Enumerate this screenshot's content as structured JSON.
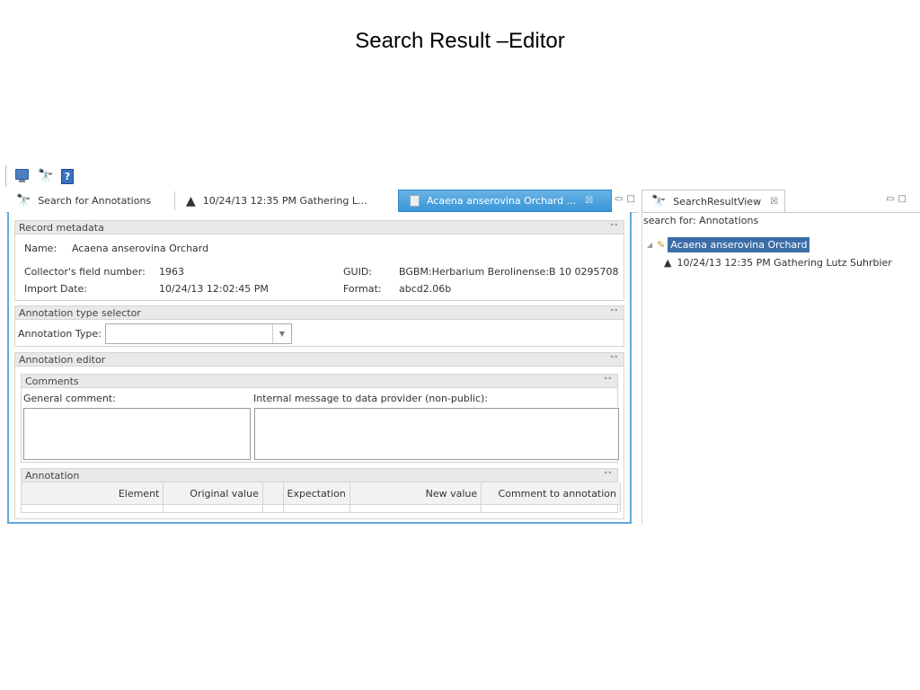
{
  "slide_title": "Search Result –Editor",
  "toolbar": {
    "icons": [
      "monitor-icon",
      "binoculars-icon",
      "help-icon"
    ]
  },
  "editor_tabs": [
    {
      "label": "Search for Annotations",
      "icon": "binoculars-icon"
    },
    {
      "label": "10/24/13 12:35 PM Gathering L...",
      "icon": "gathering-icon"
    },
    {
      "label": "Acaena anserovina Orchard ...",
      "icon": "document-icon",
      "active": true,
      "close": "☒"
    }
  ],
  "record_metadata": {
    "header": "Record metadata",
    "name_label": "Name:",
    "name_value": "Acaena anserovina Orchard",
    "field_number_label": "Collector's field number:",
    "field_number_value": "1963",
    "guid_label": "GUID:",
    "guid_value": "BGBM:Herbarium Berolinense:B 10 0295708",
    "import_label": "Import Date:",
    "import_value": "10/24/13 12:02:45 PM",
    "format_label": "Format:",
    "format_value": "abcd2.06b"
  },
  "annotation_type_selector": {
    "header": "Annotation type selector",
    "type_label": "Annotation Type:",
    "type_value": ""
  },
  "annotation_editor": {
    "header": "Annotation editor",
    "comments": {
      "header": "Comments",
      "general_label": "General comment:",
      "internal_label": "Internal message to data provider (non-public):"
    },
    "annotation": {
      "header": "Annotation",
      "columns": [
        "Element",
        "Original value",
        "Expectation",
        "New value",
        "Comment to annotation"
      ]
    }
  },
  "result_view": {
    "tab_label": "SearchResultView",
    "tab_close": "☒",
    "search_for": "search for: Annotations",
    "tree": [
      {
        "label": "Acaena anserovina Orchard",
        "selected": true
      },
      {
        "label": "10/24/13 12:35 PM Gathering Lutz Suhrbier"
      }
    ]
  },
  "colors": {
    "accent": "#3a95d6",
    "selection": "#3d6ea8",
    "section_header": "#e9e9e9"
  }
}
